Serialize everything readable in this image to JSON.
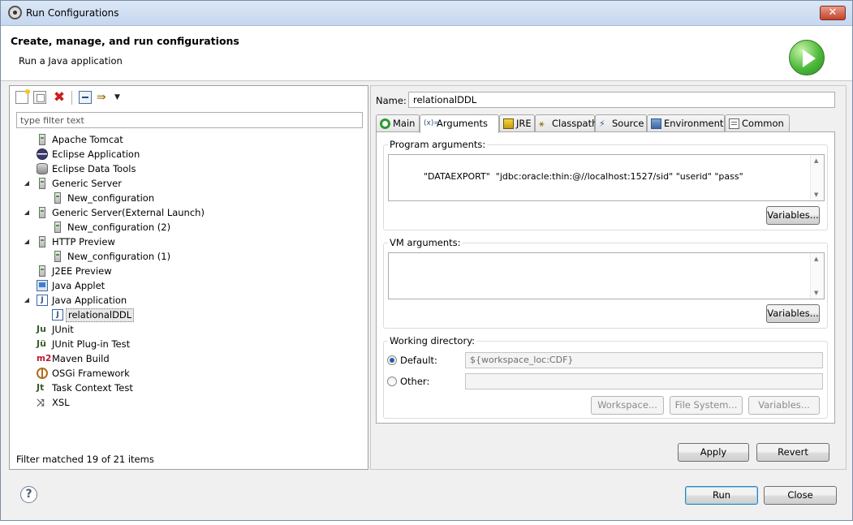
{
  "window": {
    "title": "Run Configurations",
    "close_label": "✕"
  },
  "header": {
    "title": "Create, manage, and run configurations",
    "subtitle": "Run a Java application"
  },
  "filter": {
    "placeholder": "type filter text"
  },
  "tree": [
    {
      "label": "Apache Tomcat",
      "icon": "server-icon",
      "level": 0,
      "arrow": ""
    },
    {
      "label": "Eclipse Application",
      "icon": "eclipse-icon",
      "level": 0,
      "arrow": ""
    },
    {
      "label": "Eclipse Data Tools",
      "icon": "database-icon",
      "level": 0,
      "arrow": ""
    },
    {
      "label": "Generic Server",
      "icon": "server-icon",
      "level": 0,
      "arrow": "◢"
    },
    {
      "label": "New_configuration",
      "icon": "server-icon",
      "level": 1,
      "arrow": ""
    },
    {
      "label": "Generic Server(External Launch)",
      "icon": "server-icon",
      "level": 0,
      "arrow": "◢"
    },
    {
      "label": "New_configuration (2)",
      "icon": "server-icon",
      "level": 1,
      "arrow": ""
    },
    {
      "label": "HTTP Preview",
      "icon": "server-icon",
      "level": 0,
      "arrow": "◢"
    },
    {
      "label": "New_configuration (1)",
      "icon": "server-icon",
      "level": 1,
      "arrow": ""
    },
    {
      "label": "J2EE Preview",
      "icon": "server-icon",
      "level": 0,
      "arrow": ""
    },
    {
      "label": "Java Applet",
      "icon": "applet-icon",
      "level": 0,
      "arrow": ""
    },
    {
      "label": "Java Application",
      "icon": "java-app-icon",
      "level": 0,
      "arrow": "◢"
    },
    {
      "label": "relationalDDL",
      "icon": "java-app-icon",
      "level": 1,
      "arrow": "",
      "selected": true
    },
    {
      "label": "JUnit",
      "icon": "junit-icon",
      "level": 0,
      "arrow": ""
    },
    {
      "label": "JUnit Plug-in Test",
      "icon": "junit-plugin-icon",
      "level": 0,
      "arrow": ""
    },
    {
      "label": "Maven Build",
      "icon": "maven-icon",
      "level": 0,
      "arrow": ""
    },
    {
      "label": "OSGi Framework",
      "icon": "osgi-icon",
      "level": 0,
      "arrow": ""
    },
    {
      "label": "Task Context Test",
      "icon": "task-context-icon",
      "level": 0,
      "arrow": ""
    },
    {
      "label": "XSL",
      "icon": "xsl-icon",
      "level": 0,
      "arrow": ""
    }
  ],
  "filter_status": "Filter matched 19 of 21 items",
  "config": {
    "name_label": "Name:",
    "name_value": "relationalDDL",
    "tabs": [
      {
        "label": "Main",
        "icon": "main-icon"
      },
      {
        "label": "Arguments",
        "icon": "arguments-icon",
        "active": true
      },
      {
        "label": "JRE",
        "icon": "jre-icon"
      },
      {
        "label": "Classpath",
        "icon": "classpath-icon"
      },
      {
        "label": "Source",
        "icon": "source-icon"
      },
      {
        "label": "Environment",
        "icon": "environment-icon"
      },
      {
        "label": "Common",
        "icon": "common-icon"
      }
    ],
    "program_args_label": "Program arguments:",
    "program_args_value": "\"DATAEXPORT\"  \"jdbc:oracle:thin:@//localhost:1527/sid\" \"userid\" \"pass\"",
    "vm_args_label": "VM arguments:",
    "vm_args_value": "",
    "variables_label": "Variables...",
    "working_dir_label": "Working directory:",
    "default_label": "Default:",
    "default_value": "${workspace_loc:CDF}",
    "other_label": "Other:",
    "other_value": "",
    "workspace_label": "Workspace...",
    "filesystem_label": "File System...",
    "apply_label": "Apply",
    "revert_label": "Revert"
  },
  "footer": {
    "help_label": "?",
    "run_label": "Run",
    "close_label": "Close"
  }
}
